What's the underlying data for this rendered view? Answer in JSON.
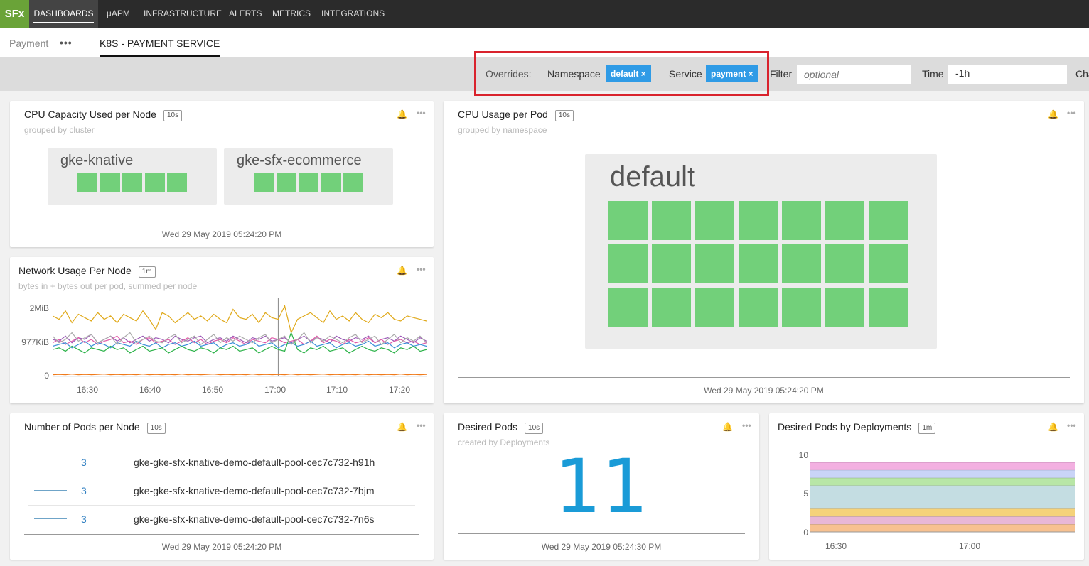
{
  "nav": {
    "logo": "SFx",
    "items": [
      "DASHBOARDS",
      "µAPM",
      "INFRASTRUCTURE",
      "ALERTS",
      "METRICS",
      "INTEGRATIONS"
    ]
  },
  "subnav": {
    "crumb": "Payment",
    "more": "•••",
    "tab": "K8S - PAYMENT SERVICE"
  },
  "filters": {
    "overrides_label": "Overrides:",
    "namespace_label": "Namespace",
    "namespace_value": "default ×",
    "service_label": "Service",
    "service_value": "payment ×",
    "filter_label": "Filter",
    "filter_placeholder": "optional",
    "time_label": "Time",
    "time_value": "-1h",
    "chart_label": "Cha"
  },
  "accent_colors": {
    "chip": "#2f9be6",
    "highlight": "#d9232d",
    "green": "#72d07a",
    "big_number": "#1a9bd7"
  },
  "card_icons": {
    "bell": "bell-icon",
    "more": "•••"
  },
  "cpu_capacity": {
    "title": "CPU Capacity Used per Node",
    "interval": "10s",
    "subtitle": "grouped by cluster",
    "groups": [
      {
        "name": "gke-knative",
        "count": 5
      },
      {
        "name": "gke-sfx-ecommerce",
        "count": 5
      }
    ],
    "timestamp": "Wed 29 May 2019 05:24:20 PM"
  },
  "cpu_pod": {
    "title": "CPU Usage per Pod",
    "interval": "10s",
    "subtitle": "grouped by namespace",
    "group": {
      "name": "default",
      "count": 21
    },
    "timestamp": "Wed 29 May 2019 05:24:20 PM"
  },
  "network": {
    "title": "Network Usage Per Node",
    "interval": "1m",
    "subtitle": "bytes in + bytes out per pod, summed per node",
    "yticks": [
      "2MiB",
      "977KiB",
      "0"
    ],
    "xticks": [
      "16:30",
      "16:40",
      "16:50",
      "17:00",
      "17:10",
      "17:20"
    ]
  },
  "pods_per_node": {
    "title": "Number of Pods per Node",
    "interval": "10s",
    "rows": [
      {
        "value": "3",
        "name": "gke-gke-sfx-knative-demo-default-pool-cec7c732-h91h"
      },
      {
        "value": "3",
        "name": "gke-gke-sfx-knative-demo-default-pool-cec7c732-7bjm"
      },
      {
        "value": "3",
        "name": "gke-gke-sfx-knative-demo-default-pool-cec7c732-7n6s"
      }
    ],
    "timestamp": "Wed 29 May 2019 05:24:20 PM"
  },
  "desired_pods": {
    "title": "Desired Pods",
    "interval": "10s",
    "subtitle": "created by Deployments",
    "value": "11",
    "timestamp": "Wed 29 May 2019 05:24:30 PM"
  },
  "desired_by_deploy": {
    "title": "Desired Pods by Deployments",
    "interval": "1m",
    "yticks": [
      "10",
      "5",
      "0"
    ],
    "xticks": [
      "16:30",
      "17:00"
    ]
  },
  "chart_data": [
    {
      "type": "line",
      "title": "Network Usage Per Node",
      "ylabel": "",
      "yticks": [
        "0",
        "977KiB",
        "2MiB"
      ],
      "x": [
        "16:25",
        "16:26",
        "16:27",
        "16:28",
        "16:29",
        "16:30",
        "16:31",
        "16:32",
        "16:33",
        "16:34",
        "16:35",
        "16:36",
        "16:37",
        "16:38",
        "16:39",
        "16:40",
        "16:41",
        "16:42",
        "16:43",
        "16:44",
        "16:45",
        "16:46",
        "16:47",
        "16:48",
        "16:49",
        "16:50",
        "16:51",
        "16:52",
        "16:53",
        "16:54",
        "16:55",
        "16:56",
        "16:57",
        "16:58",
        "16:59",
        "17:00",
        "17:01",
        "17:02",
        "17:03",
        "17:04",
        "17:05",
        "17:06",
        "17:07",
        "17:08",
        "17:09",
        "17:10",
        "17:11",
        "17:12",
        "17:13",
        "17:14",
        "17:15",
        "17:16",
        "17:17",
        "17:18",
        "17:19",
        "17:20",
        "17:21",
        "17:22",
        "17:23"
      ],
      "ylim": [
        0,
        2.2
      ],
      "series": [
        {
          "color": "#e0a91a",
          "values": [
            1.8,
            1.7,
            1.95,
            1.6,
            1.85,
            1.75,
            1.65,
            1.9,
            1.7,
            1.8,
            1.6,
            1.85,
            1.75,
            1.65,
            1.95,
            1.7,
            1.4,
            1.9,
            1.8,
            1.6,
            1.75,
            1.9,
            1.7,
            1.8,
            1.65,
            1.85,
            1.7,
            1.6,
            2.0,
            1.75,
            1.7,
            1.85,
            1.6,
            1.9,
            1.75,
            1.7,
            2.1,
            1.3,
            1.7,
            1.8,
            1.9,
            1.75,
            1.6,
            1.95,
            1.7,
            1.8,
            1.65,
            1.9,
            1.7,
            1.6,
            1.85,
            1.75,
            1.9,
            1.7,
            1.65,
            1.8,
            1.75,
            1.7,
            1.65
          ]
        },
        {
          "color": "#9b59b6",
          "values": [
            1.1,
            1.05,
            1.2,
            1.0,
            1.15,
            1.1,
            1.25,
            1.0,
            1.1,
            1.2,
            1.05,
            1.15,
            1.0,
            1.1,
            1.2,
            1.05,
            1.15,
            1.1,
            1.0,
            1.2,
            1.1,
            1.05,
            1.15,
            1.2,
            1.0,
            1.1,
            1.15,
            1.05,
            1.2,
            1.1,
            1.0,
            1.15,
            1.1,
            1.2,
            1.05,
            1.1,
            1.15,
            1.0,
            1.1,
            1.2,
            1.05,
            1.15,
            1.1,
            1.0,
            1.2,
            1.1,
            1.05,
            1.15,
            1.1,
            1.2,
            1.0,
            1.1,
            1.15,
            1.05,
            1.2,
            1.1,
            1.0,
            1.15,
            1.05
          ]
        },
        {
          "color": "#e05aa8",
          "values": [
            1.0,
            1.1,
            0.95,
            1.05,
            1.15,
            1.0,
            1.1,
            0.95,
            1.05,
            1.1,
            1.2,
            1.0,
            1.05,
            0.95,
            1.1,
            1.15,
            1.0,
            1.05,
            1.1,
            0.95,
            1.05,
            1.15,
            1.0,
            1.1,
            0.95,
            1.05,
            1.1,
            1.0,
            1.15,
            1.05,
            0.95,
            1.1,
            1.05,
            1.0,
            1.15,
            1.1,
            1.0,
            1.05,
            1.1,
            0.95,
            1.05,
            1.2,
            1.0,
            1.1,
            1.05,
            0.95,
            1.1,
            1.0,
            1.05,
            1.15,
            1.0,
            1.1,
            0.95,
            1.05,
            1.1,
            1.0,
            1.05,
            0.95,
            1.0
          ]
        },
        {
          "color": "#3a8fd8",
          "values": [
            0.9,
            0.95,
            1.0,
            0.85,
            0.95,
            1.05,
            0.9,
            1.0,
            0.95,
            0.85,
            1.0,
            0.95,
            0.9,
            1.05,
            0.95,
            0.9,
            1.0,
            0.85,
            0.95,
            1.0,
            0.9,
            0.95,
            1.05,
            0.9,
            0.95,
            1.0,
            0.85,
            0.95,
            1.0,
            0.9,
            0.95,
            1.05,
            0.9,
            0.95,
            1.0,
            0.85,
            0.95,
            1.0,
            0.9,
            0.95,
            1.05,
            0.9,
            0.95,
            1.0,
            0.85,
            0.95,
            1.0,
            0.9,
            0.95,
            1.05,
            0.9,
            0.95,
            1.0,
            0.85,
            0.95,
            1.0,
            0.9,
            0.95,
            0.9
          ]
        },
        {
          "color": "#2db34a",
          "values": [
            0.8,
            0.85,
            0.75,
            0.9,
            0.8,
            0.7,
            0.85,
            0.8,
            0.75,
            0.9,
            0.8,
            0.85,
            0.7,
            0.8,
            0.9,
            0.75,
            0.8,
            0.85,
            0.7,
            0.8,
            0.9,
            0.8,
            0.75,
            0.85,
            0.8,
            0.7,
            0.85,
            0.8,
            0.9,
            0.75,
            0.8,
            0.85,
            0.7,
            0.8,
            0.9,
            0.8,
            0.75,
            1.3,
            0.8,
            0.7,
            0.85,
            0.8,
            0.9,
            0.75,
            0.8,
            0.85,
            0.7,
            0.8,
            0.9,
            0.8,
            0.75,
            0.85,
            0.8,
            0.7,
            0.85,
            0.8,
            0.9,
            0.75,
            0.8
          ]
        },
        {
          "color": "#aaaaaa",
          "values": [
            1.2,
            1.0,
            1.1,
            1.3,
            1.05,
            1.15,
            1.25,
            1.0,
            1.1,
            1.2,
            0.95,
            1.15,
            1.3,
            1.0,
            1.1,
            1.2,
            1.05,
            1.0,
            1.15,
            1.25,
            1.0,
            1.1,
            1.2,
            0.95,
            1.1,
            1.25,
            1.0,
            1.15,
            1.05,
            1.2,
            1.1,
            1.0,
            1.15,
            1.25,
            1.0,
            1.1,
            1.2,
            0.95,
            1.1,
            1.3,
            1.0,
            1.15,
            1.05,
            1.2,
            1.1,
            1.0,
            1.15,
            1.25,
            1.0,
            1.1,
            1.2,
            0.95,
            1.1,
            1.25,
            1.0,
            1.15,
            1.05,
            1.2,
            1.0
          ]
        },
        {
          "color": "#f07a1a",
          "values": [
            0.05,
            0.06,
            0.05,
            0.07,
            0.05,
            0.06,
            0.05,
            0.06,
            0.07,
            0.05,
            0.06,
            0.05,
            0.06,
            0.05,
            0.07,
            0.05,
            0.06,
            0.05,
            0.06,
            0.05,
            0.07,
            0.05,
            0.06,
            0.05,
            0.06,
            0.07,
            0.05,
            0.06,
            0.05,
            0.06,
            0.05,
            0.07,
            0.05,
            0.06,
            0.05,
            0.06,
            0.05,
            0.07,
            0.05,
            0.06,
            0.05,
            0.06,
            0.07,
            0.05,
            0.06,
            0.05,
            0.06,
            0.05,
            0.07,
            0.05,
            0.06,
            0.05,
            0.06,
            0.05,
            0.07,
            0.05,
            0.06,
            0.05,
            0.06
          ]
        }
      ]
    },
    {
      "type": "area",
      "title": "Desired Pods by Deployments",
      "yticks": [
        "0",
        "5",
        "10"
      ],
      "ylim": [
        0,
        11.5
      ],
      "x": [
        "16:25",
        "17:23"
      ],
      "series": [
        {
          "color": "#f7c190",
          "values": [
            1,
            1
          ]
        },
        {
          "color": "#e8b7d6",
          "values": [
            1,
            1
          ]
        },
        {
          "color": "#f5d27a",
          "values": [
            1,
            1
          ]
        },
        {
          "color": "#c4dde2",
          "values": [
            3,
            3
          ]
        },
        {
          "color": "#b8e6a6",
          "values": [
            1,
            1
          ]
        },
        {
          "color": "#c9d4f7",
          "values": [
            1,
            1
          ]
        },
        {
          "color": "#f3b0e1",
          "values": [
            1,
            1
          ]
        }
      ]
    }
  ]
}
